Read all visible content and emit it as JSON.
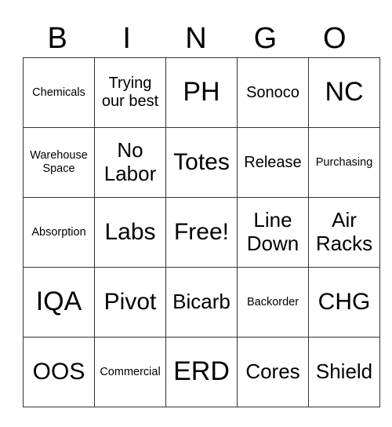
{
  "title_letters": [
    "B",
    "I",
    "N",
    "G",
    "O"
  ],
  "rows": [
    [
      "Chemicals",
      "Trying our best",
      "PH",
      "Sonoco",
      "NC"
    ],
    [
      "Warehouse Space",
      "No Labor",
      "Totes",
      "Release",
      "Purchasing"
    ],
    [
      "Absorption",
      "Labs",
      "Free!",
      "Line Down",
      "Air Racks"
    ],
    [
      "IQA",
      "Pivot",
      "Bicarb",
      "Backorder",
      "CHG"
    ],
    [
      "OOS",
      "Commercial",
      "ERD",
      "Cores",
      "Shield"
    ]
  ]
}
